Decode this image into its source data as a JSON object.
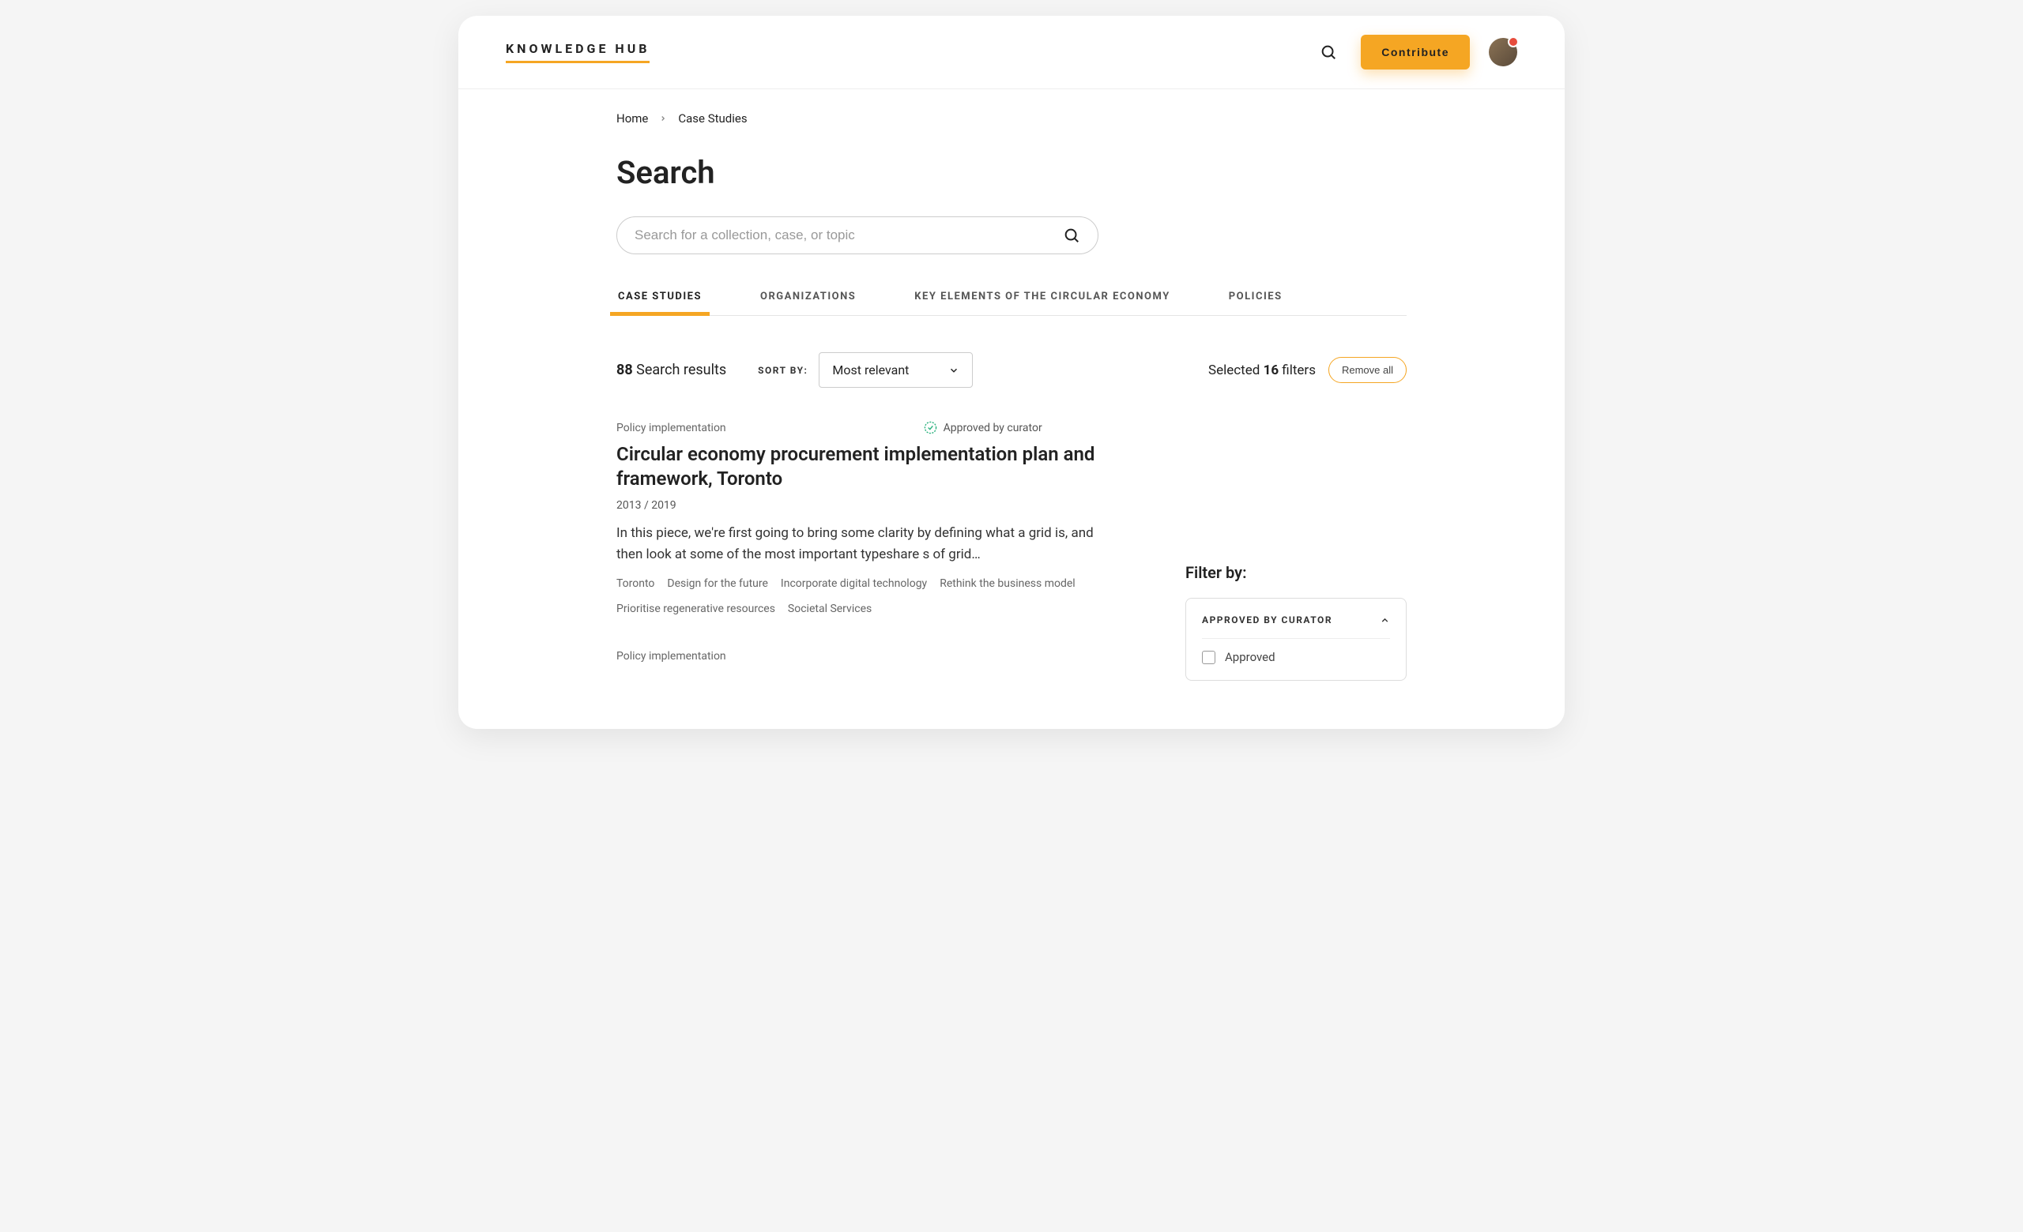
{
  "header": {
    "logo": "KNOWLEDGE HUB",
    "contribute_label": "Contribute"
  },
  "breadcrumb": {
    "home": "Home",
    "current": "Case Studies"
  },
  "page_title": "Search",
  "search": {
    "placeholder": "Search for a collection, case, or topic"
  },
  "tabs": [
    "CASE STUDIES",
    "ORGANIZATIONS",
    "KEY ELEMENTS OF THE CIRCULAR ECONOMY",
    "POLICIES"
  ],
  "results": {
    "count": "88",
    "count_label": "Search results",
    "sort_label": "SORT BY:",
    "sort_value": "Most relevant",
    "selected_prefix": "Selected",
    "selected_count": "16",
    "selected_suffix": "filters",
    "remove_all": "Remove all"
  },
  "items": [
    {
      "category": "Policy implementation",
      "approved": "Approved by curator",
      "title": "Circular economy procurement implementation plan and framework, Toronto",
      "date": "2013 / 2019",
      "excerpt": "In this piece, we're first going to bring some clarity by defining what a grid is, and then look at some of the most important typeshare s of grid…",
      "tags": [
        "Toronto",
        "Design for the future",
        "Incorporate digital technology",
        "Rethink the business model",
        "Prioritise regenerative resources",
        "Societal Services"
      ]
    },
    {
      "category": "Policy implementation"
    }
  ],
  "filter": {
    "title": "Filter by:",
    "group_label": "APPROVED BY CURATOR",
    "option": "Approved"
  }
}
